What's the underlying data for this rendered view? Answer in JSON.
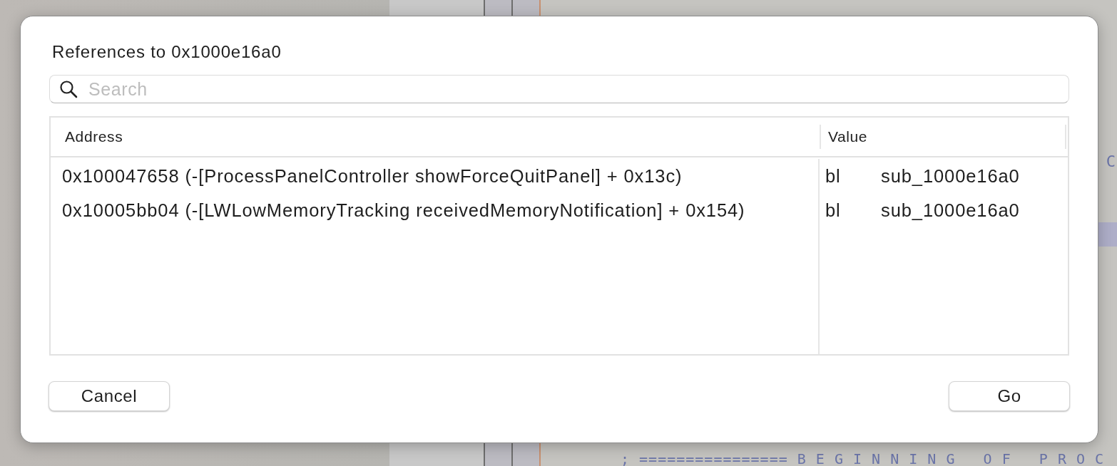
{
  "background": {
    "side_mark": "C",
    "code_line": "; ================ B E G I N N I N G   O F   P R O C"
  },
  "dialog": {
    "title": "References to 0x1000e16a0",
    "search": {
      "placeholder": "Search"
    },
    "table": {
      "columns": [
        "Address",
        "Value"
      ],
      "rows": [
        {
          "address": "0x100047658 (-[ProcessPanelController showForceQuitPanel] + 0x13c)",
          "instruction": "bl",
          "operand": "sub_1000e16a0",
          "selected": false
        },
        {
          "address": "0x10005bb04 (-[LWLowMemoryTracking receivedMemoryNotification] + 0x154)",
          "instruction": "bl",
          "operand": "sub_1000e16a0",
          "selected": false
        }
      ]
    },
    "buttons": [
      {
        "label": "Cancel",
        "kind": "cancel"
      },
      {
        "label": "Go",
        "kind": "default"
      }
    ]
  }
}
